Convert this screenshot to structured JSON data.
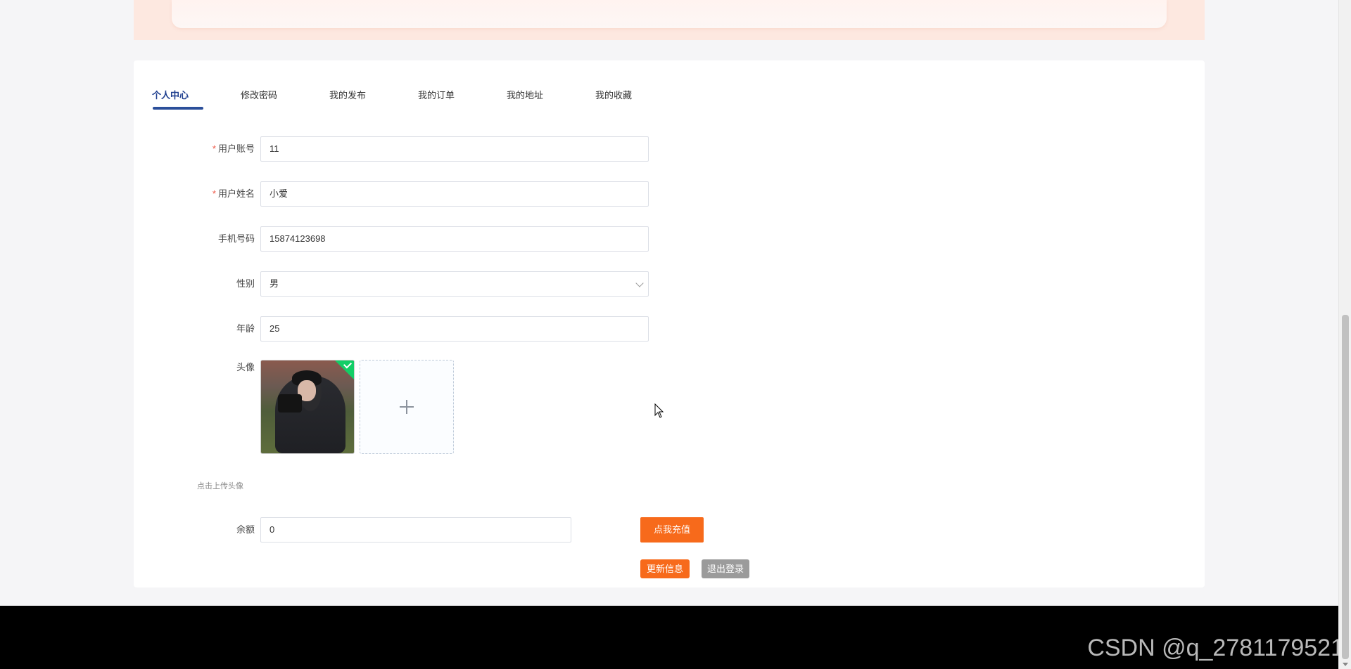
{
  "tabs": [
    {
      "label": "个人中心",
      "active": true
    },
    {
      "label": "修改密码"
    },
    {
      "label": "我的发布"
    },
    {
      "label": "我的订单"
    },
    {
      "label": "我的地址"
    },
    {
      "label": "我的收藏"
    }
  ],
  "form": {
    "account": {
      "label": "用户账号",
      "value": "11",
      "required": true
    },
    "name": {
      "label": "用户姓名",
      "value": "小爱",
      "required": true
    },
    "phone": {
      "label": "手机号码",
      "value": "15874123698"
    },
    "gender": {
      "label": "性别",
      "value": "男"
    },
    "age": {
      "label": "年龄",
      "value": "25"
    },
    "avatar": {
      "label": "头像",
      "hint": "点击上传头像"
    },
    "balance": {
      "label": "余额",
      "value": "0",
      "recharge_label": "点我充值"
    }
  },
  "required_mark": "*",
  "actions": {
    "update_label": "更新信息",
    "logout_label": "退出登录"
  },
  "watermark": "CSDN @q_2781179521",
  "colors": {
    "accent": "#f76a1b",
    "tab_active": "#2b4f9a",
    "success": "#13ce66"
  }
}
